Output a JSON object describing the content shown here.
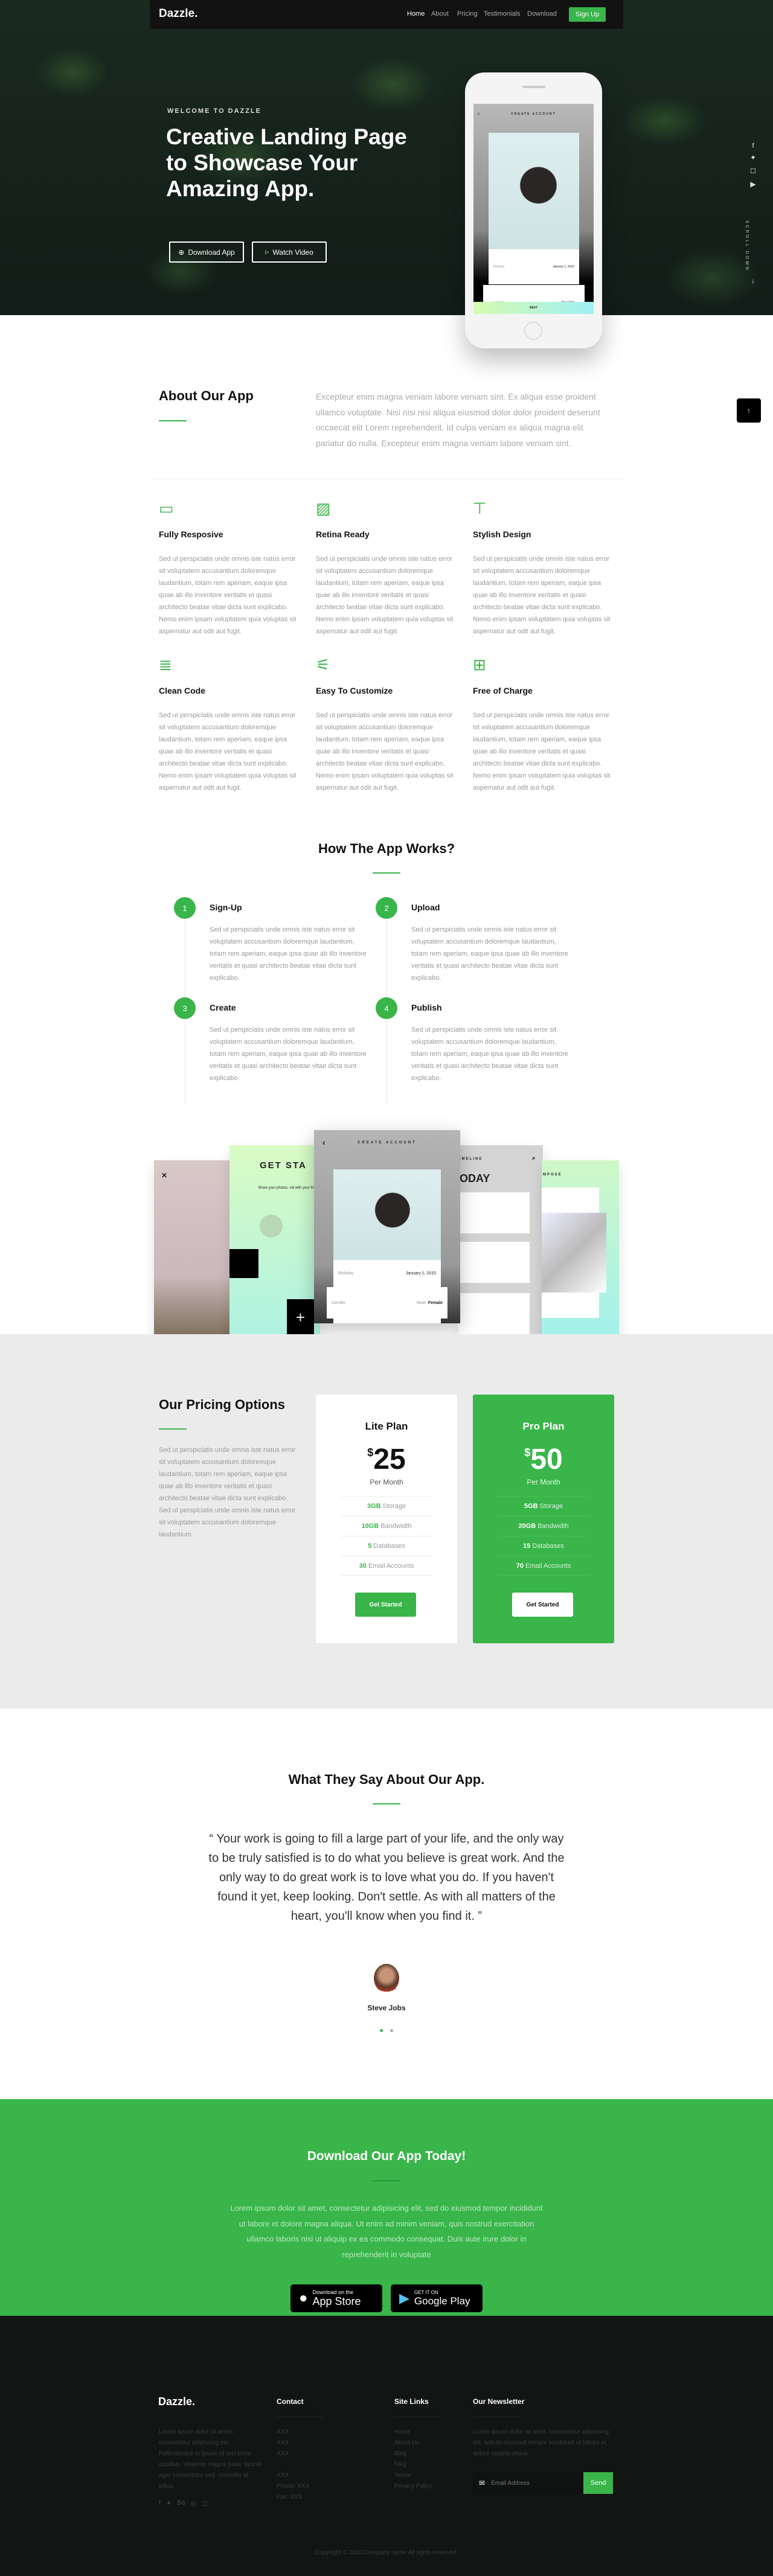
{
  "nav": {
    "logo": "Dazzle.",
    "links": [
      "Home",
      "About",
      "Pricing",
      "Testimonials",
      "Download"
    ],
    "signup": "Sign Up"
  },
  "hero": {
    "welcome": "WELCOME TO DAZZLE",
    "headline": "Creative Landing Page to Showcase Your Amazing App.",
    "download_btn": "Download App",
    "video_btn": "Watch Video",
    "scroll": "SCROLL DOWN",
    "social_icons": [
      "facebook-icon",
      "twitter-icon",
      "instagram-icon",
      "youtube-icon"
    ]
  },
  "phone": {
    "title": "CREATE ACCOUNT",
    "birthday_label": "Birthday",
    "birthday": "January 1, 2015",
    "gender_label": "Gender",
    "gender_male": "Male",
    "gender_female": "Female",
    "location_label": "Location",
    "location": "New York",
    "next": "NEXT"
  },
  "about": {
    "title": "About Our App",
    "text": "Excepteur enim magna veniam labore veniam sint. Ex aliqua esse proident ullamco voluptate. Nisi nisi nisi aliqua eiusmod dolor dolor proident deserunt occaecat elit Lorem reprehenderit. Id culpa veniam ex aliqua magna elit pariatur do nulla. Excepteur enim magna veniam labore veniam sint.",
    "features": [
      {
        "icon": "browser-window-icon",
        "glyph": "▭",
        "title": "Fully Resposive"
      },
      {
        "icon": "image-icon",
        "glyph": "▨",
        "title": "Retina Ready"
      },
      {
        "icon": "paint-brush-icon",
        "glyph": "⊤",
        "title": "Stylish Design"
      },
      {
        "icon": "document-icon",
        "glyph": "≣",
        "title": "Clean Code"
      },
      {
        "icon": "sliders-icon",
        "glyph": "⚟",
        "title": "Easy To Customize"
      },
      {
        "icon": "gift-icon",
        "glyph": "⊞",
        "title": "Free of Charge"
      }
    ],
    "feature_text": "Sed ut perspiciatis unde omnis iste natus error sit voluptatem accusantium doloremque laudantium, totam rem aperiam, eaque ipsa quae ab illo inventore veritatis et quasi architecto beatae vitae dicta sunt explicabo. Nemo enim ipsam voluptatem quia voluptas sit aspernatur aut odit aut fugit."
  },
  "works": {
    "title": "How The App Works?",
    "steps": [
      {
        "n": "1",
        "title": "Sign-Up"
      },
      {
        "n": "2",
        "title": "Upload"
      },
      {
        "n": "3",
        "title": "Create"
      },
      {
        "n": "4",
        "title": "Publish"
      }
    ],
    "text": "Sed ut perspiciatis unde omnis iste natus error sit voluptatem accusantium doloremque laudantium, totam rem aperiam, eaque ipsa quae ab illo inventore veritatis et quasi architecto beatae vitae dicta sunt explicabo."
  },
  "screens": {
    "get_started": "GET STA",
    "share": "Share your photos, vid with your frie",
    "timeline": "IMELINE",
    "today": "ODAY",
    "compose": "MPOSE"
  },
  "pricing": {
    "title": "Our Pricing Options",
    "text": "Sed ut perspiciatis unde omnis iste natus error sit voluptatem accusantium doloremque laudantium, totam rem aperiam, eaque ipsa quae ab illo inventore veritatis et quasi architecto beatae vitae dicta sunt explicabo. Sed ut perspiciatis unde omnis iste natus error sit voluptatem accusantium doloremque laudantium.",
    "plans": [
      {
        "name": "Lite Plan",
        "currency": "$",
        "price": "25",
        "period": "Per Month",
        "features": [
          [
            "3GB",
            "Storage"
          ],
          [
            "10GB",
            "Bandwidth"
          ],
          [
            "5",
            "Databases"
          ],
          [
            "30",
            "Email Accounts"
          ]
        ],
        "cta": "Get Started"
      },
      {
        "name": "Pro Plan",
        "currency": "$",
        "price": "50",
        "period": "Per Month",
        "features": [
          [
            "5GB",
            "Storage"
          ],
          [
            "20GB",
            "Bandwidth"
          ],
          [
            "15",
            "Databases"
          ],
          [
            "70",
            "Email Accounts"
          ]
        ],
        "cta": "Get Started"
      }
    ]
  },
  "testimonials": {
    "title": "What They Say About Our App.",
    "quote": "“ Your work is going to fill a large part of your life, and the only way to be truly satisfied is to do what you believe is great work. And the only way to do great work is to love what you do. If you haven't found it yet, keep looking. Don't settle. As with all matters of the heart, you'll know when you find it. ”",
    "author": "Steve Jobs",
    "active_slide": 1,
    "slides": 2
  },
  "download": {
    "title": "Download Our App Today!",
    "text": "Lorem ipsum dolor sit amet, consectetur adipisicing elit, sed do eiusmod tempor incididunt ut labore et dolore magna aliqua. Ut enim ad minim veniam, quis nostrud exercitation ullamco laboris nisi ut aliquip ex ea commodo consequat. Duis aute irure dolor in reprehenderit in voluptate",
    "appstore_small": "Download on the",
    "appstore_big": "App Store",
    "play_small": "GET IT ON",
    "play_big": "Google Play"
  },
  "footer": {
    "logo": "Dazzle.",
    "about": "Lorem ipsum dolor sit amet, consectetur adipiscing elit. Pellentesque in ipsum id orci porta dapibus. Vivamus magna justo, lacinia eget consectetur sed, convallis at tellus.",
    "contact_title": "Contact",
    "contact": [
      "XXX",
      "XXX",
      "XXX",
      "",
      "XXX",
      "Phone: XXX",
      "Fax: XXX"
    ],
    "links_title": "Site Links",
    "links": [
      "Home",
      "About Us",
      "Blog",
      "FAQ",
      "Terms",
      "Privacy Policy"
    ],
    "newsletter_title": "Our Newsletter",
    "newsletter_text": "Lorem ipsum dolor sit amet, consectetur adipiscing elit, sed do eiusmod tempor incididunt ut labore et dolore magna aliqua.",
    "email_placeholder": "Email Address",
    "send": "Send",
    "social_icons": [
      "facebook-icon",
      "twitter-icon",
      "behance-icon",
      "dribbble-icon",
      "instagram-icon"
    ],
    "copyright": "Copyright © 2020.Company name All rights reserved."
  },
  "colors": {
    "accent": "#39b54a",
    "dark": "#131515",
    "gray_bg": "#ebebeb"
  }
}
